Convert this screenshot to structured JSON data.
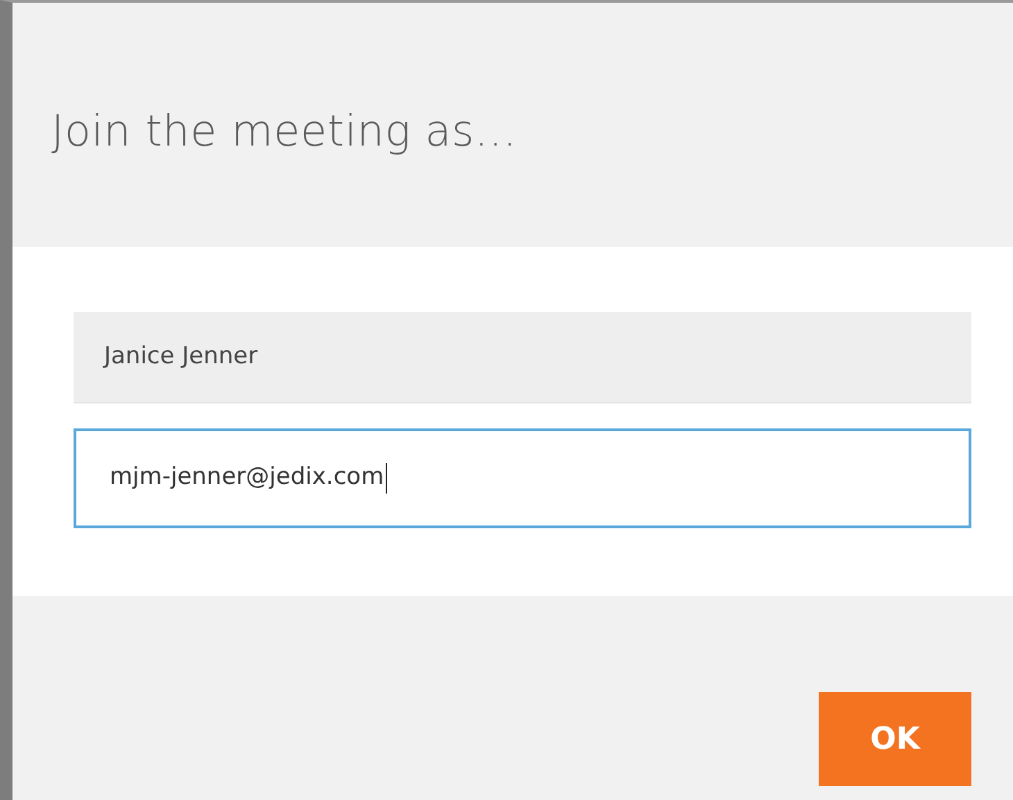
{
  "dialog": {
    "title": "Join the meeting as..."
  },
  "fields": [
    {
      "kind": "filled",
      "value": "Janice Jenner",
      "focused": false
    },
    {
      "kind": "input",
      "value": "mjm-jenner@jedix.com",
      "focused": true
    }
  ],
  "buttons": [
    {
      "label": "OK"
    }
  ]
}
